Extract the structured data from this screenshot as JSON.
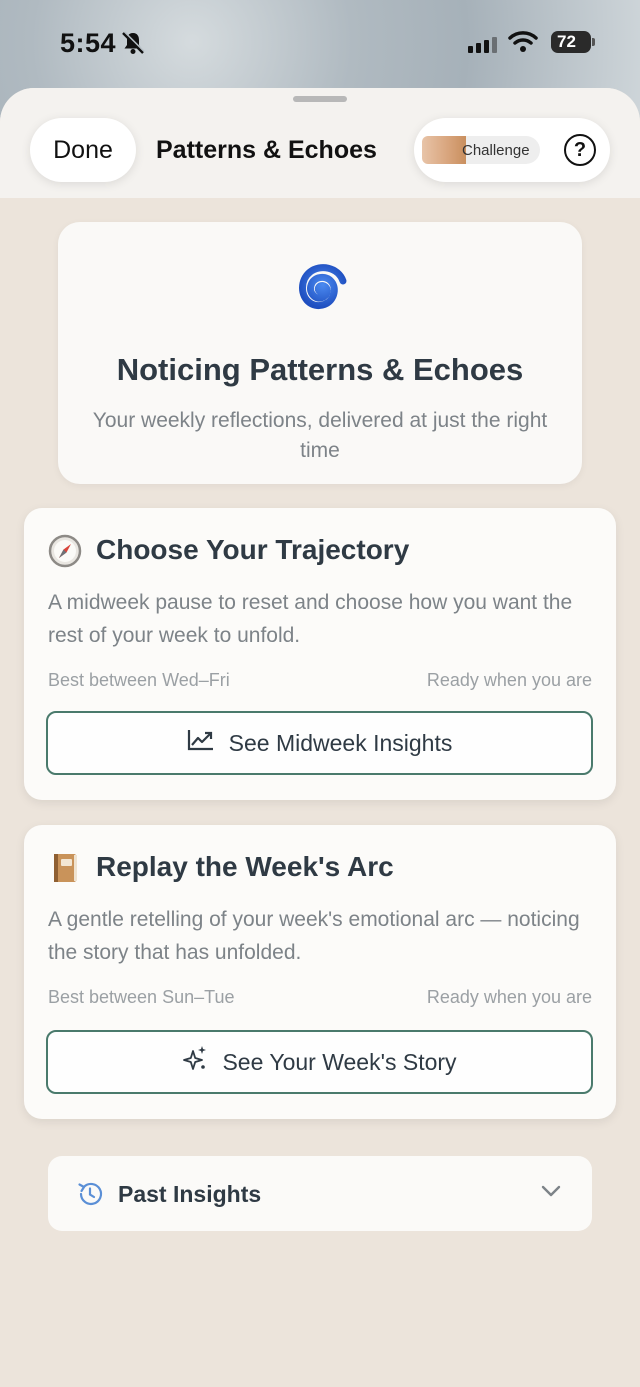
{
  "status_bar": {
    "time": "5:54",
    "battery": "72"
  },
  "header": {
    "done_label": "Done",
    "title": "Patterns & Echoes",
    "challenge_label": "Challenge",
    "help_label": "?"
  },
  "hero": {
    "icon": "spiral-icon",
    "title": "Noticing Patterns & Echoes",
    "subtitle": "Your weekly reflections, delivered at just the right time"
  },
  "cards": [
    {
      "icon": "compass-icon",
      "title": "Choose Your Trajectory",
      "description": "A midweek pause to reset and choose how you want the rest of your week to unfold.",
      "best_time": "Best between Wed–Fri",
      "status": "Ready when you are",
      "button_icon": "chart-line-icon",
      "button_label": "See Midweek Insights"
    },
    {
      "icon": "book-icon",
      "title": "Replay the Week's Arc",
      "description": "A gentle retelling of your week's emotional arc — noticing the story that has unfolded.",
      "best_time": "Best between Sun–Tue",
      "status": "Ready when you are",
      "button_icon": "sparkles-icon",
      "button_label": "See Your Week's Story"
    }
  ],
  "past_insights": {
    "icon": "history-icon",
    "label": "Past Insights"
  },
  "colors": {
    "accent_border": "#4a7a6c",
    "sheet_bg": "#ece4db",
    "title_text": "#2f3a44",
    "muted_text": "#7d8388",
    "spiral_blue": "#2f63d6"
  }
}
